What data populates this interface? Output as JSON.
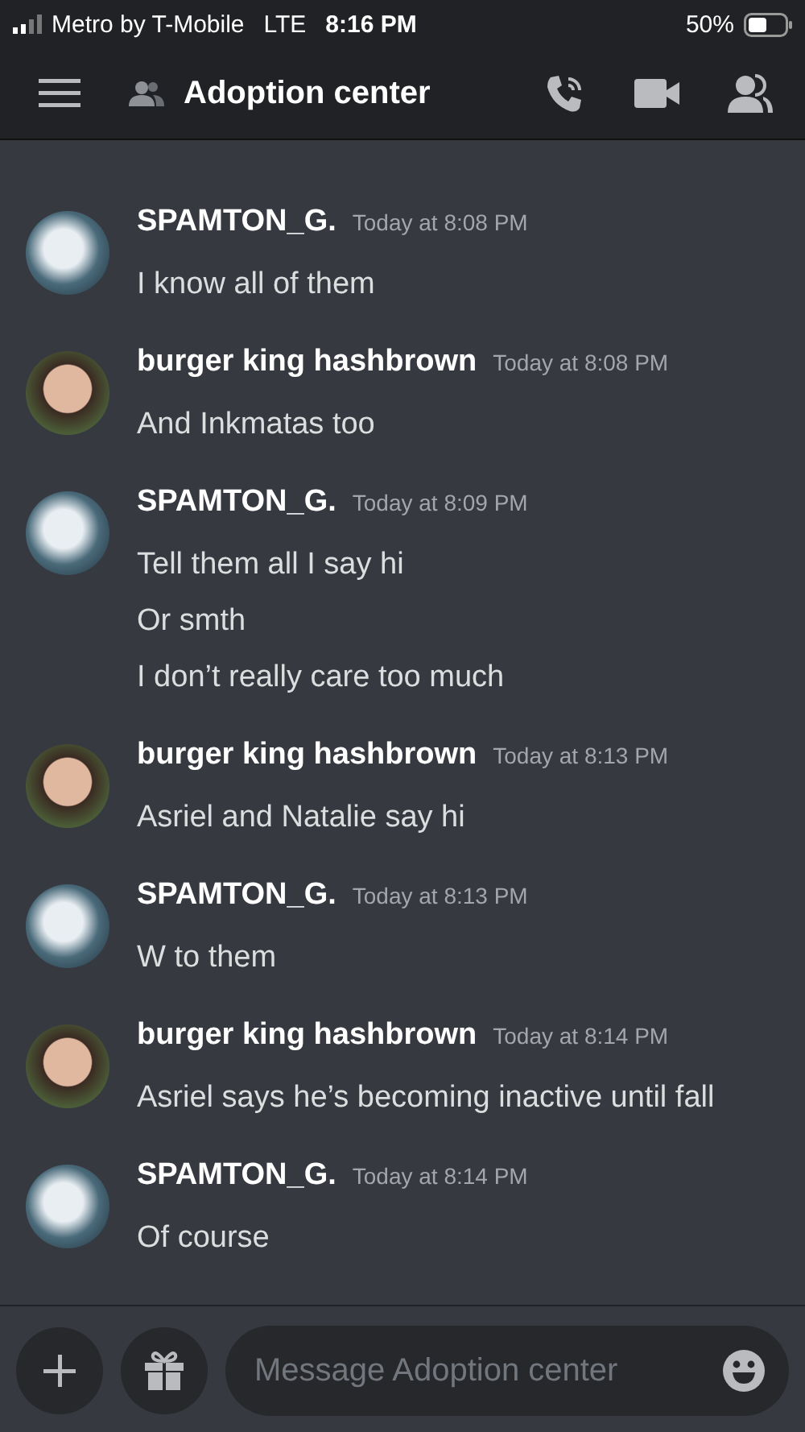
{
  "status_bar": {
    "carrier": "Metro by T-Mobile",
    "network": "LTE",
    "time": "8:16 PM",
    "battery": "50%"
  },
  "header": {
    "title": "Adoption center"
  },
  "messages": [
    {
      "author": "SPAMTON_G.",
      "timestamp": "Today at 8:08 PM",
      "kind": "art",
      "lines": [
        "I know all of them"
      ]
    },
    {
      "author": "burger king hashbrown",
      "timestamp": "Today at 8:08 PM",
      "kind": "photo",
      "lines": [
        "And Inkmatas too"
      ]
    },
    {
      "author": "SPAMTON_G.",
      "timestamp": "Today at 8:09 PM",
      "kind": "art",
      "lines": [
        "Tell them all I say hi",
        "Or smth",
        "I don’t really care too much"
      ]
    },
    {
      "author": "burger king hashbrown",
      "timestamp": "Today at 8:13 PM",
      "kind": "photo",
      "lines": [
        "Asriel and Natalie say hi"
      ]
    },
    {
      "author": "SPAMTON_G.",
      "timestamp": "Today at 8:13 PM",
      "kind": "art",
      "lines": [
        "W to them"
      ]
    },
    {
      "author": "burger king hashbrown",
      "timestamp": "Today at 8:14 PM",
      "kind": "photo",
      "lines": [
        "Asriel says he’s becoming inactive until fall"
      ]
    },
    {
      "author": "SPAMTON_G.",
      "timestamp": "Today at 8:14 PM",
      "kind": "art",
      "lines": [
        "Of course"
      ]
    }
  ],
  "composer": {
    "placeholder": "Message Adoption center"
  }
}
